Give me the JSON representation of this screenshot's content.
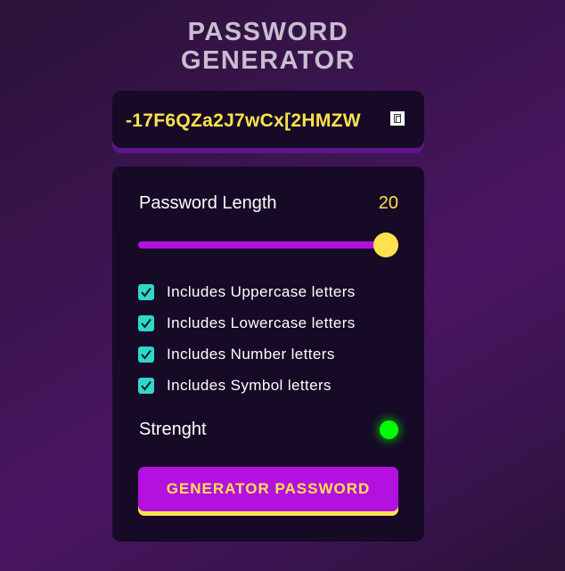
{
  "header": {
    "title_line1": "PASSWORD",
    "title_line2": "GENERATOR"
  },
  "password": {
    "value": "-17F6QZa2J7wCx[2HMZW",
    "copy_icon": "copy-icon"
  },
  "length": {
    "label": "Password Length",
    "value": "20",
    "slider_fraction": 1.0
  },
  "options": [
    {
      "label": "Includes Uppercase letters",
      "checked": true
    },
    {
      "label": "Includes Lowercase letters",
      "checked": true
    },
    {
      "label": "Includes Number letters",
      "checked": true
    },
    {
      "label": "Includes Symbol letters",
      "checked": true
    }
  ],
  "strength": {
    "label": "Strenght",
    "indicator_color": "#00ff00"
  },
  "generate_button": {
    "label": "GENERATOR PASSWORD"
  },
  "colors": {
    "accent": "#b411e0",
    "highlight": "#ffe14d",
    "checkbox": "#2ed8cb",
    "panel": "#160a26"
  }
}
